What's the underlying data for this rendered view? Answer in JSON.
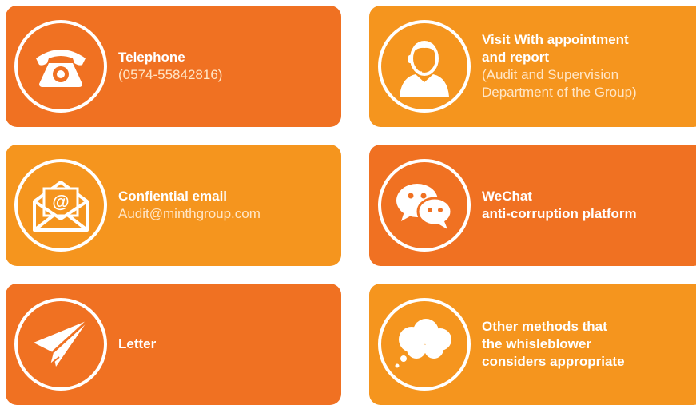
{
  "cards": {
    "telephone": {
      "icon": "telephone-icon",
      "title": "Telephone",
      "detail": "(0574-55842816)"
    },
    "visit": {
      "icon": "person-headset-icon",
      "title": "Visit With appointment\nand report",
      "detail": "(Audit and Supervision\nDepartment of the Group)"
    },
    "email": {
      "icon": "email-envelope-icon",
      "title": "Confiential email",
      "detail": "Audit@minthgroup.com"
    },
    "wechat": {
      "icon": "wechat-icon",
      "title": "WeChat\nanti-corruption platform"
    },
    "letter": {
      "icon": "paper-plane-icon",
      "title": "Letter"
    },
    "other": {
      "icon": "thought-cloud-icon",
      "title": "Other methods that\nthe whisleblower\nconsiders appropriate"
    }
  },
  "colors": {
    "dark_orange": "#f07122",
    "light_orange": "#f5951e",
    "detail_text": "#ffe6c7"
  }
}
